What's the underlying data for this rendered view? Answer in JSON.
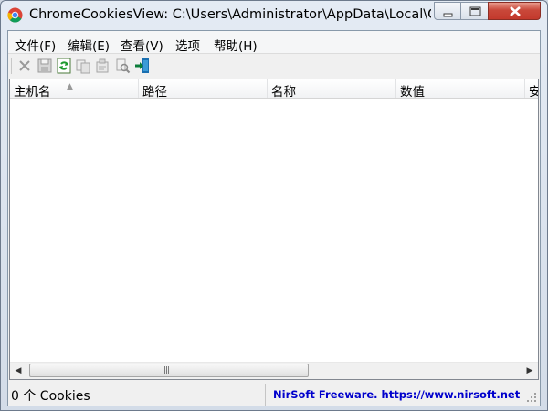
{
  "window": {
    "title": "ChromeCookiesView:   C:\\Users\\Administrator\\AppData\\Local\\Google\\Chrome\\User Data\\Default\\Cookies",
    "icon": "chrome-icon",
    "controls": [
      "minimize-icon",
      "maximize-icon",
      "close-icon"
    ]
  },
  "menu": {
    "file": "文件(F)",
    "edit": "编辑(E)",
    "view": "查看(V)",
    "options": "选项",
    "help": "帮助(H)"
  },
  "toolbar": {
    "icons": [
      "delete-icon",
      "save-icon",
      "refresh-icon",
      "copy-icon",
      "properties-icon",
      "find-icon",
      "exit-icon"
    ]
  },
  "list": {
    "columns": [
      "主机名",
      "路径",
      "名称",
      "数值",
      "安"
    ],
    "sort_icon": "sort-ascending-icon",
    "rows": []
  },
  "status": {
    "count": "0 个 Cookies",
    "credit": "NirSoft Freeware. https://www.nirsoft.net"
  }
}
